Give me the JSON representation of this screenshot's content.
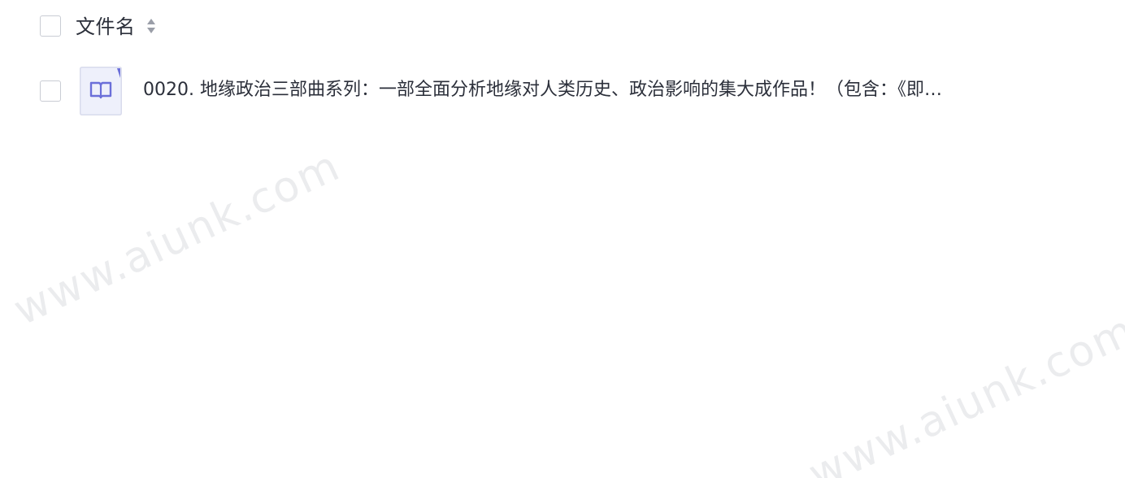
{
  "header": {
    "column_title": "文件名"
  },
  "files": [
    {
      "name": "0020. 地缘政治三部曲系列：一部全面分析地缘对人类历史、政治影响的集大成作品！（包含：《即…",
      "icon": "book-icon"
    }
  ],
  "watermark": "www.aiunk.com",
  "colors": {
    "icon_accent": "#6b6fd9",
    "icon_bg": "#eef0fb",
    "text": "#2b2f3a",
    "checkbox_border": "#c9ccd4"
  }
}
